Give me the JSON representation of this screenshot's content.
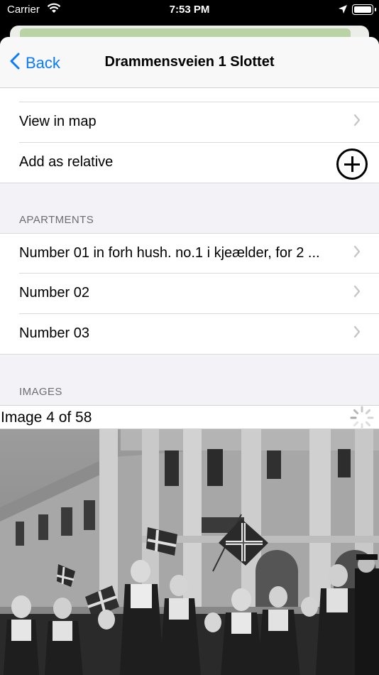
{
  "status_bar": {
    "carrier": "Carrier",
    "time": "7:53 PM"
  },
  "nav": {
    "back_label": "Back",
    "title": "Drammensveien 1 Slottet"
  },
  "rows_top": {
    "view_in_map": "View in map",
    "add_as_relative": "Add as relative"
  },
  "apartments": {
    "header": "APARTMENTS",
    "items": [
      "Number 01 in forh hush. no.1 i kjeælder, for 2 ...",
      "Number 02",
      "Number 03"
    ]
  },
  "images": {
    "header": "IMAGES",
    "caption": "Image 4 of 58"
  },
  "icons": {
    "wifi": "wifi-icon",
    "location": "location-arrow-icon",
    "battery": "battery-icon",
    "back": "chevron-left-icon",
    "disclosure": "chevron-right-icon",
    "add": "plus-circle-icon",
    "loading": "activity-spinner-icon"
  },
  "colors": {
    "accent": "#0a7aff",
    "grouped_background": "#f2f2f7",
    "section_text": "#6d6d72",
    "chevron": "#c4c4c7"
  }
}
